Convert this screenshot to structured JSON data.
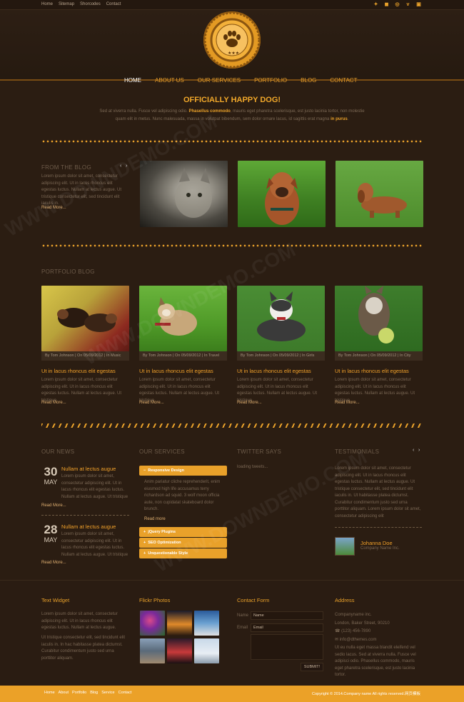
{
  "topbar": {
    "links": [
      "Home",
      "Sitemap",
      "Shorcodes",
      "Contact"
    ],
    "social": [
      "delicious-icon",
      "stumbleupon-icon",
      "dribbble-icon",
      "vimeo-icon",
      "flickr-icon"
    ]
  },
  "logo": {
    "text": "CERTIFIED BY INTERNATIONAL UNITED DOGS COUNCIL"
  },
  "nav": [
    "HOME",
    "ABOUT US",
    "OUR SERVICES",
    "PORTFOLIO",
    "BLOG",
    "CONTACT"
  ],
  "hero": {
    "title": "OFFICIALLY HAPPY DOG!",
    "lead": "Sed at viverra nulla. Fusce vel adipiscing odio. ",
    "bold1": "Phasellus commodo",
    "mid": ", mauris eget pharetra scelerisque, est justo lacinia tortor, non molestie quam elit in metus. Nunc malesuada, massa in volutpat bibendum, sem dolor ornare lacus, id sagittis erat magna ",
    "bold2": "in purus",
    "end": "."
  },
  "from_blog": {
    "title": "FROM THE BLOG",
    "text": "Lorem ipsum dolor sit amet, consectetur adipiscing elit. Ut in lacus rhoncus elit egestas luctus. Nullam at lectus augue. Ut tristique consectetur elit, sed tincidunt elit iaculis in.",
    "read_more": "Read More...",
    "images": [
      "cat-photo",
      "boxer-dog-photo",
      "dachshund-photo"
    ]
  },
  "portfolio": {
    "title": "PORTFOLIO BLOG",
    "items": [
      {
        "caption": "By Tom Johnson | On 05/09/2012 | In Music",
        "title": "Ut in lacus rhoncus elit egestas",
        "text": "Lorem ipsum dolor sit amet, consectetur adipiscing elit. Ut in lacus rhoncus elit egestas luctus. Nullam at lectus augue. Ut tristique",
        "read_more": "Read More..."
      },
      {
        "caption": "By Tom Johnson | On 05/09/2012 | In Travel",
        "title": "Ut in lacus rhoncus elit egestas",
        "text": "Lorem ipsum dolor sit amet, consectetur adipiscing elit. Ut in lacus rhoncus elit egestas luctus. Nullam at lectus augue. Ut tristique",
        "read_more": "Read More..."
      },
      {
        "caption": "By Tom Johnson | On 05/09/2012 | In Girls",
        "title": "Ut in lacus rhoncus elit egestas",
        "text": "Lorem ipsum dolor sit amet, consectetur adipiscing elit. Ut in lacus rhoncus elit egestas luctus. Nullam at lectus augue. Ut tristique",
        "read_more": "Read More..."
      },
      {
        "caption": "By Tom Johnson | On 05/09/2012 | In City",
        "title": "Ut in lacus rhoncus elit egestas",
        "text": "Lorem ipsum dolor sit amet, consectetur adipiscing elit. Ut in lacus rhoncus elit egestas luctus. Nullam at lectus augue. Ut tristique",
        "read_more": "Read More..."
      }
    ]
  },
  "news": {
    "title": "OUR NEWS",
    "items": [
      {
        "day": "30",
        "month": "MAY",
        "title": "Nullam at lectus augue",
        "text": "Lorem ipsum dolor sit amet, consectetur adipiscing elit. Ut in lacus rhoncus elit egestas luctus. Nullam at lectus augue. Ut tristique",
        "read_more": "Read More..."
      },
      {
        "day": "28",
        "month": "MAY",
        "title": "Nullam at lectus augue",
        "text": "Lorem ipsum dolor sit amet, consectetur adipiscing elit. Ut in lacus rhoncus elit egestas luctus. Nullam at lectus augue. Ut tristique",
        "read_more": "Read More..."
      }
    ]
  },
  "services": {
    "title": "OUR SERVICES",
    "open": {
      "label": "Responsive Design",
      "text": "Anim pariatur cliche reprehenderit, enim eiusmod high life accusamus terry richardson ad squid. 3 wolf moon officia aute, non cupidatat skateboard dolor brunch.",
      "read_more": "Read more"
    },
    "closed": [
      "jQuery Plugins",
      "SEO Optimization",
      "Unquestionable Style"
    ]
  },
  "twitter": {
    "title": "TWITTER SAYS",
    "loading": "loading tweets..."
  },
  "testimonials": {
    "title": "TESTIMONIALS",
    "text": "Lorem ipsum dolor sit amet, consectetur adipiscing elit. Ut in lacus rhoncus elit egestas luctus. Nullam at lectus augue. Ut tristique consectetur elit, sed tincidunt elit iaculis in. Ut habitasse platea dictumst. Curabitur condimentum justo sed urna porttitor aliquam. Lorem ipsum dolor sit amet, consectetur adipiscing elit",
    "name": "Johanna Doe",
    "company": "Company Name Inc."
  },
  "footer": {
    "text_widget": {
      "title": "Text Widget",
      "p1": "Lorem ipsum dolor sit amet, consectetur adipiscing elit. Ut in lacus rhoncus elit egestas luctus. Nullam at lectus augue.",
      "p2": "Ut tristique consectetur elit, sed tincidunt elit iaculis in. In hac habitasse platea dictumst. Curabitur condimentum justo sed urna porttitor aliquam."
    },
    "flickr": {
      "title": "Flickr Photos"
    },
    "contact": {
      "title": "Contact Form",
      "name_label": "Name",
      "name_value": "Name",
      "email_label": "Email",
      "email_value": "Email",
      "submit": "SUBMIT!"
    },
    "address": {
      "title": "Address",
      "company": "Companyname inc.",
      "street": "London, Baker Street, 90210",
      "phone": "(123) 456-7890",
      "email": "info@dthemes.com",
      "about": "Ut eu nulla eget massa blandit eleifend vel sedio lacus. Sed at viverra nulla. Fusce vel adipisci odio. Phasellus commodo, mauris eget pharetra scelerisque, est justo lacinia tortor."
    }
  },
  "bottom": {
    "links": [
      "Home",
      "About",
      "Portfolio",
      "Blog",
      "Service",
      "Contact"
    ],
    "copyright": "Copyright © 2014.Company name All rights reserved.网页模板"
  },
  "colors": {
    "background": "#2b1d12",
    "accent": "#e9a12a",
    "footer_bar": "#eba128"
  },
  "watermark": "WWW.DOWNDEMO.COM"
}
